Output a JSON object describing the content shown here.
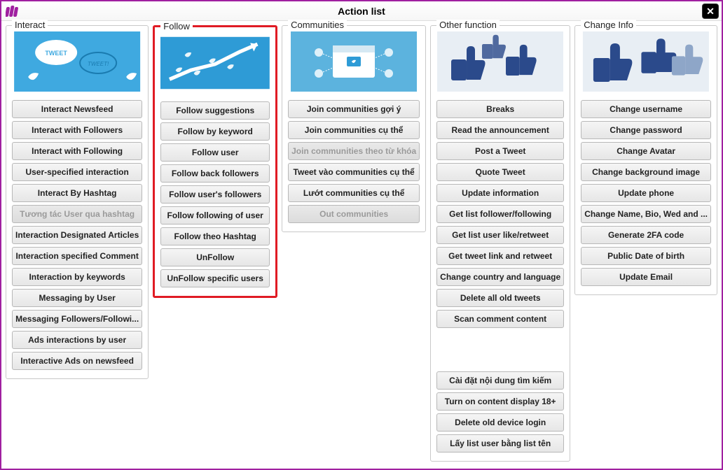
{
  "window": {
    "title": "Action list"
  },
  "groups": {
    "interact": {
      "title": "Interact",
      "buttons": [
        {
          "label": "Interact Newsfeed",
          "enabled": true
        },
        {
          "label": "Interact with Followers",
          "enabled": true
        },
        {
          "label": "Interact with Following",
          "enabled": true
        },
        {
          "label": "User-specified interaction",
          "enabled": true
        },
        {
          "label": "Interact By Hashtag",
          "enabled": true
        },
        {
          "label": "Tương tác User qua hashtag",
          "enabled": false
        },
        {
          "label": "Interaction Designated Articles",
          "enabled": true
        },
        {
          "label": "Interaction specified Comment",
          "enabled": true
        },
        {
          "label": "Interaction by keywords",
          "enabled": true
        },
        {
          "label": "Messaging by User",
          "enabled": true
        },
        {
          "label": "Messaging Followers/Followi...",
          "enabled": true
        },
        {
          "label": "Ads interactions by user",
          "enabled": true
        },
        {
          "label": "Interactive Ads on newsfeed",
          "enabled": true
        }
      ]
    },
    "follow": {
      "title": "Follow",
      "buttons": [
        {
          "label": "Follow suggestions",
          "enabled": true
        },
        {
          "label": "Follow by keyword",
          "enabled": true
        },
        {
          "label": "Follow user",
          "enabled": true
        },
        {
          "label": "Follow back followers",
          "enabled": true
        },
        {
          "label": "Follow user's followers",
          "enabled": true
        },
        {
          "label": "Follow following of user",
          "enabled": true
        },
        {
          "label": "Follow theo Hashtag",
          "enabled": true
        },
        {
          "label": "UnFollow",
          "enabled": true
        },
        {
          "label": "UnFollow specific users",
          "enabled": true
        }
      ]
    },
    "communities": {
      "title": "Communities",
      "buttons": [
        {
          "label": "Join communities gợi ý",
          "enabled": true
        },
        {
          "label": "Join communities cụ thể",
          "enabled": true
        },
        {
          "label": "Join communities theo từ khóa",
          "enabled": false
        },
        {
          "label": "Tweet vào communities cụ thể",
          "enabled": true
        },
        {
          "label": "Lướt communities cụ thể",
          "enabled": true
        },
        {
          "label": "Out communities",
          "enabled": false
        }
      ]
    },
    "other": {
      "title": "Other function",
      "buttons_top": [
        {
          "label": "Breaks",
          "enabled": true
        },
        {
          "label": "Read the announcement",
          "enabled": true
        },
        {
          "label": "Post a Tweet",
          "enabled": true
        },
        {
          "label": "Quote  Tweet",
          "enabled": true
        },
        {
          "label": "Update information",
          "enabled": true
        },
        {
          "label": "Get list follower/following",
          "enabled": true
        },
        {
          "label": "Get list user like/retweet",
          "enabled": true
        },
        {
          "label": "Get tweet link and retweet",
          "enabled": true
        },
        {
          "label": "Change country and language",
          "enabled": true
        },
        {
          "label": "Delete all old tweets",
          "enabled": true
        },
        {
          "label": "Scan comment content",
          "enabled": true
        }
      ],
      "buttons_bottom": [
        {
          "label": "Cài đặt nội dung tìm kiếm",
          "enabled": true
        },
        {
          "label": "Turn on content display 18+",
          "enabled": true
        },
        {
          "label": "Delete old device login",
          "enabled": true
        },
        {
          "label": "Lấy list user bằng list tên",
          "enabled": true
        }
      ]
    },
    "change": {
      "title": "Change Info",
      "buttons": [
        {
          "label": "Change username",
          "enabled": true
        },
        {
          "label": "Change password",
          "enabled": true
        },
        {
          "label": "Change Avatar",
          "enabled": true
        },
        {
          "label": "Change background image",
          "enabled": true
        },
        {
          "label": "Update phone",
          "enabled": true
        },
        {
          "label": "Change Name, Bio, Wed and ...",
          "enabled": true
        },
        {
          "label": "Generate 2FA code",
          "enabled": true
        },
        {
          "label": "Public Date of birth",
          "enabled": true
        },
        {
          "label": "Update Email",
          "enabled": true
        }
      ]
    }
  }
}
